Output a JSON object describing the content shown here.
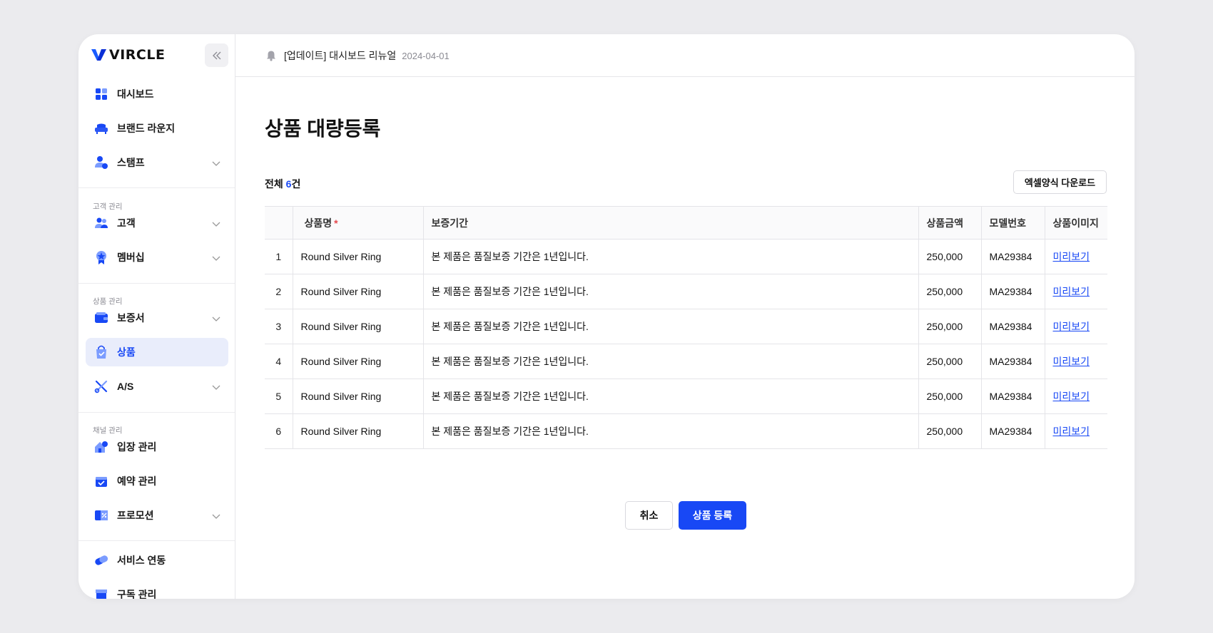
{
  "brand": {
    "name": "VIRCLE"
  },
  "header": {
    "notice_text": "[업데이트] 대시보드 리뉴얼",
    "notice_date": "2024-04-01"
  },
  "sidebar": {
    "items": [
      {
        "label": "대시보드"
      },
      {
        "label": "브랜드 라운지"
      },
      {
        "label": "스탬프"
      },
      {
        "label": "고객"
      },
      {
        "label": "멤버십"
      },
      {
        "label": "보증서"
      },
      {
        "label": "상품"
      },
      {
        "label": "A/S"
      },
      {
        "label": "입장 관리"
      },
      {
        "label": "예약 관리"
      },
      {
        "label": "프로모션"
      },
      {
        "label": "서비스 연동"
      },
      {
        "label": "구독 관리"
      }
    ],
    "sections": {
      "customer": "고객 관리",
      "product": "상품 관리",
      "channel": "채널 관리"
    },
    "active_item": "상품"
  },
  "main": {
    "title": "상품 대량등록",
    "total_prefix": "전체 ",
    "total_count": "6",
    "total_suffix": "건",
    "excel_button": "엑셀양식 다운로드",
    "table": {
      "columns": [
        "",
        "상품명",
        "보증기간",
        "상품금액",
        "모델번호",
        "상품이미지"
      ],
      "required_marker": "*",
      "rows": [
        {
          "no": "1",
          "name": "Round Silver Ring",
          "warranty": "본 제품은 품질보증 기간은 1년입니다.",
          "price": "250,000",
          "model": "MA29384",
          "image": "미리보기"
        },
        {
          "no": "2",
          "name": "Round Silver Ring",
          "warranty": "본 제품은 품질보증 기간은 1년입니다.",
          "price": "250,000",
          "model": "MA29384",
          "image": "미리보기"
        },
        {
          "no": "3",
          "name": "Round Silver Ring",
          "warranty": "본 제품은 품질보증 기간은 1년입니다.",
          "price": "250,000",
          "model": "MA29384",
          "image": "미리보기"
        },
        {
          "no": "4",
          "name": "Round Silver Ring",
          "warranty": "본 제품은 품질보증 기간은 1년입니다.",
          "price": "250,000",
          "model": "MA29384",
          "image": "미리보기"
        },
        {
          "no": "5",
          "name": "Round Silver Ring",
          "warranty": "본 제품은 품질보증 기간은 1년입니다.",
          "price": "250,000",
          "model": "MA29384",
          "image": "미리보기"
        },
        {
          "no": "6",
          "name": "Round Silver Ring",
          "warranty": "본 제품은 품질보증 기간은 1년입니다.",
          "price": "250,000",
          "model": "MA29384",
          "image": "미리보기"
        }
      ]
    },
    "cancel_button": "취소",
    "submit_button": "상품 등록"
  },
  "colors": {
    "accent": "#1848f5",
    "required": "#e5484d",
    "background": "#ebebee"
  }
}
